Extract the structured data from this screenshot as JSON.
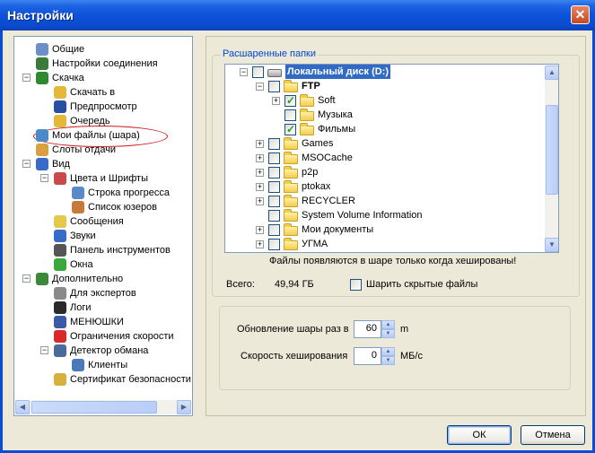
{
  "window": {
    "title": "Настройки"
  },
  "nav": {
    "items": [
      {
        "label": "Общие",
        "level": 1,
        "icon": "users-icon",
        "color": "#6b8fc8",
        "expander": ""
      },
      {
        "label": "Настройки соединения",
        "level": 1,
        "icon": "network-icon",
        "color": "#3a7a3a",
        "expander": ""
      },
      {
        "label": "Скачка",
        "level": 1,
        "icon": "download-icon",
        "color": "#2f8a2f",
        "expander": "−"
      },
      {
        "label": "Скачать в",
        "level": 2,
        "icon": "folder-icon",
        "color": "#e4b83a",
        "expander": ""
      },
      {
        "label": "Предпросмотр",
        "level": 2,
        "icon": "preview-icon",
        "color": "#2a4fa0",
        "expander": ""
      },
      {
        "label": "Очередь",
        "level": 2,
        "icon": "queue-icon",
        "color": "#e4b83a",
        "expander": ""
      },
      {
        "label": "Мои файлы (шара)",
        "level": 1,
        "icon": "share-icon",
        "color": "#4a8ac8",
        "expander": ""
      },
      {
        "label": "Слоты отдачи",
        "level": 1,
        "icon": "slots-icon",
        "color": "#d8a040",
        "expander": ""
      },
      {
        "label": "Вид",
        "level": 1,
        "icon": "view-icon",
        "color": "#3a6ac8",
        "expander": "−"
      },
      {
        "label": "Цвета и Шрифты",
        "level": 2,
        "icon": "colors-icon",
        "color": "#c84a4a",
        "expander": "−"
      },
      {
        "label": "Строка прогресса",
        "level": 3,
        "icon": "progress-icon",
        "color": "#5a8ac8",
        "expander": ""
      },
      {
        "label": "Список юзеров",
        "level": 3,
        "icon": "user-list-icon",
        "color": "#c87a3a",
        "expander": ""
      },
      {
        "label": "Сообщения",
        "level": 2,
        "icon": "messages-icon",
        "color": "#e4c84a",
        "expander": ""
      },
      {
        "label": "Звуки",
        "level": 2,
        "icon": "sounds-icon",
        "color": "#3a6ac8",
        "expander": ""
      },
      {
        "label": "Панель инструментов",
        "level": 2,
        "icon": "toolbar-icon",
        "color": "#555555",
        "expander": ""
      },
      {
        "label": "Окна",
        "level": 2,
        "icon": "windows-icon",
        "color": "#3aa83a",
        "expander": ""
      },
      {
        "label": "Дополнительно",
        "level": 1,
        "icon": "advanced-icon",
        "color": "#3a8a3a",
        "expander": "−"
      },
      {
        "label": "Для экспертов",
        "level": 2,
        "icon": "experts-icon",
        "color": "#8a8a8a",
        "expander": ""
      },
      {
        "label": "Логи",
        "level": 2,
        "icon": "logs-icon",
        "color": "#2a2a2a",
        "expander": ""
      },
      {
        "label": "МЕНЮШКИ",
        "level": 2,
        "icon": "menus-icon",
        "color": "#3a5aa8",
        "expander": ""
      },
      {
        "label": "Ограничения скорости",
        "level": 2,
        "icon": "speed-limit-icon",
        "color": "#d82a2a",
        "expander": ""
      },
      {
        "label": "Детектор обмана",
        "level": 2,
        "icon": "detector-icon",
        "color": "#4a6a9a",
        "expander": "−"
      },
      {
        "label": "Клиенты",
        "level": 3,
        "icon": "clients-icon",
        "color": "#4a7ab8",
        "expander": ""
      },
      {
        "label": "Сертификат безопасности",
        "level": 2,
        "icon": "certificate-icon",
        "color": "#d8b040",
        "expander": ""
      }
    ]
  },
  "shared_folders": {
    "legend": "Расшаренные папки",
    "tree": [
      {
        "label": "Локальный диск (D:)",
        "level": 0,
        "checked": false,
        "expander": "−",
        "kind": "drive"
      },
      {
        "label": "FTP",
        "level": 1,
        "checked": false,
        "expander": "−",
        "kind": "folder"
      },
      {
        "label": "Soft",
        "level": 2,
        "checked": true,
        "expander": "+",
        "kind": "folder"
      },
      {
        "label": "Музыка",
        "level": 2,
        "checked": false,
        "expander": "",
        "kind": "folder"
      },
      {
        "label": "Фильмы",
        "level": 2,
        "checked": true,
        "expander": "",
        "kind": "folder"
      },
      {
        "label": "Games",
        "level": 1,
        "checked": false,
        "expander": "+",
        "kind": "folder"
      },
      {
        "label": "MSOCache",
        "level": 1,
        "checked": false,
        "expander": "+",
        "kind": "folder"
      },
      {
        "label": "p2p",
        "level": 1,
        "checked": false,
        "expander": "+",
        "kind": "folder"
      },
      {
        "label": "ptokax",
        "level": 1,
        "checked": false,
        "expander": "+",
        "kind": "folder"
      },
      {
        "label": "RECYCLER",
        "level": 1,
        "checked": false,
        "expander": "+",
        "kind": "folder"
      },
      {
        "label": "System Volume Information",
        "level": 1,
        "checked": false,
        "expander": "",
        "kind": "folder"
      },
      {
        "label": "Мои документы",
        "level": 1,
        "checked": false,
        "expander": "+",
        "kind": "folder"
      },
      {
        "label": "УГМА",
        "level": 1,
        "checked": false,
        "expander": "+",
        "kind": "folder"
      }
    ],
    "note": "Файлы появляются в шаре только когда хешированы!",
    "total_label": "Всего:",
    "total_value": "49,94 ГБ",
    "hidden_files_label": "Шарить скрытые файлы"
  },
  "settings": {
    "refresh_label": "Обновление шары раз в",
    "refresh_value": "60",
    "refresh_unit": "m",
    "hash_speed_label": "Скорость хеширования",
    "hash_speed_value": "0",
    "hash_speed_unit": "МБ/с"
  },
  "buttons": {
    "ok": "ОК",
    "cancel": "Отмена"
  },
  "selection_highlight": "#d01818"
}
